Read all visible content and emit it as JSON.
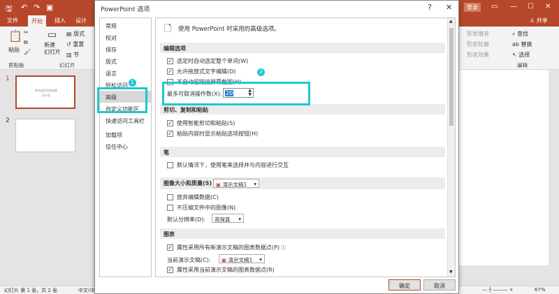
{
  "app": {
    "tabs": [
      "文件",
      "开始",
      "插入",
      "设计"
    ],
    "active_tab": "开始",
    "share": "共享",
    "sign_in": "登录"
  },
  "ribbon": {
    "paste": "粘贴",
    "new_slide": "新建\n幻灯片",
    "layout": "版式",
    "reset": "重置",
    "section": "节",
    "clipboard": "剪贴板",
    "slides": "幻灯片",
    "shape_fill": "形状填充",
    "shape_outline": "形状轮廓",
    "shape_effect": "形状效果",
    "find": "查找",
    "replace": "替换",
    "select": "选择",
    "editing": "编辑"
  },
  "thumbs": {
    "n1": "1",
    "n2": "2",
    "t1_title": "单击此处添加标题",
    "t1_sub": "副标题"
  },
  "status": {
    "slide": "幻灯片 第 1 张，共 2 张",
    "lang": "中文(中",
    "zoom": "67%"
  },
  "dialog": {
    "title": "PowerPoint 选项",
    "help": "?",
    "close": "✕",
    "nav": [
      "常规",
      "校对",
      "保存",
      "版式",
      "语言",
      "轻松访问",
      "高级",
      "自定义功能区",
      "快速访问工具栏",
      "加载项",
      "信任中心"
    ],
    "header_text": "使用 PowerPoint 时采用的高级选项。",
    "sec_edit": "编辑选项",
    "opt1": "选定时自动选定整个单词(W)",
    "opt2": "允许拖放式文字编辑(D)",
    "opt3": "不自动超链接屏幕截图(H)",
    "undo_label": "最多可取消操作数(X):",
    "undo_value": "20",
    "sec_clip": "剪切、复制和粘贴",
    "opt4": "使用智能剪切和粘贴(S)",
    "opt5": "粘贴内容时显示粘贴选项按钮(H)",
    "sec_pen": "笔",
    "opt6": "默认情况下，使用笔来选择并与内容进行交互",
    "sec_img": "图像大小和质量(S)",
    "img_doc": "演示文稿1",
    "opt7": "放弃编辑数据(C)",
    "opt8": "不压缩文件中的图像(N)",
    "res_label": "默认分辨率(D):",
    "res_value": "高保真",
    "sec_chart": "图表",
    "opt9": "属性采用所有新演示文稿的图表数据点(P)",
    "cur_label": "当前演示文稿(C):",
    "cur_doc": "演示文稿1",
    "opt10": "属性采用当前演示文稿的图表数据点(R)",
    "ok": "确定",
    "cancel": "取消",
    "badge1": "1",
    "badge2": "2"
  },
  "colors": {
    "accent": "#b7472a",
    "highlight": "#1ec8d0"
  }
}
